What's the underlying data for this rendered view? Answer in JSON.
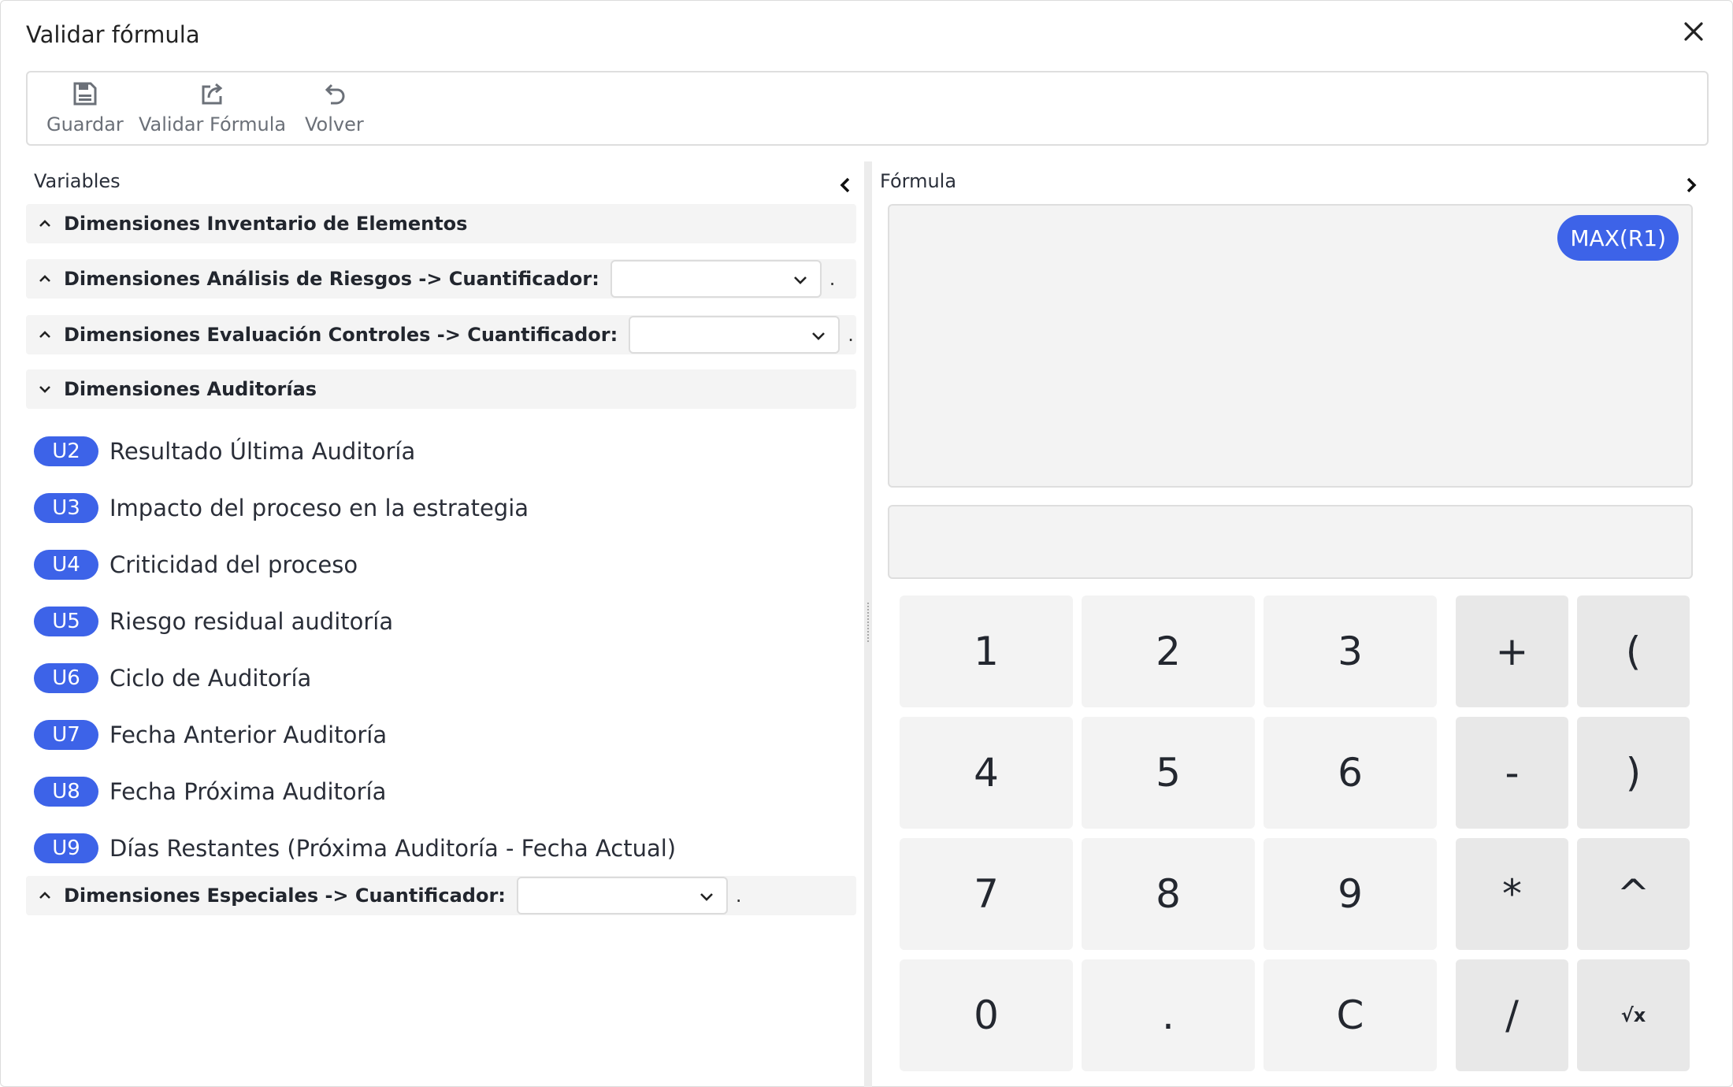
{
  "dialog": {
    "title": "Validar fórmula"
  },
  "toolbar": {
    "save_label": "Guardar",
    "validate_label": "Validar Fórmula",
    "back_label": "Volver"
  },
  "variables_panel": {
    "title": "Variables",
    "sections": [
      {
        "label": "Dimensiones Inventario de Elementos"
      },
      {
        "label": "Dimensiones Análisis de Riesgos -> Cuantificador:",
        "select_value": "",
        "suffix": "."
      },
      {
        "label": "Dimensiones Evaluación Controles -> Cuantificador:",
        "select_value": "",
        "suffix": "."
      },
      {
        "label": "Dimensiones Auditorías"
      },
      {
        "label": "Dimensiones Especiales -> Cuantificador:",
        "select_value": "",
        "suffix": "."
      }
    ],
    "audit_items": [
      {
        "code": "U2",
        "label": "Resultado Última Auditoría"
      },
      {
        "code": "U3",
        "label": "Impacto del proceso en la estrategia"
      },
      {
        "code": "U4",
        "label": "Criticidad del proceso"
      },
      {
        "code": "U5",
        "label": "Riesgo residual auditoría"
      },
      {
        "code": "U6",
        "label": "Ciclo de Auditoría"
      },
      {
        "code": "U7",
        "label": "Fecha Anterior Auditoría"
      },
      {
        "code": "U8",
        "label": "Fecha Próxima Auditoría"
      },
      {
        "code": "U9",
        "label": "Días Restantes (Próxima Auditoría - Fecha Actual)"
      }
    ]
  },
  "formula_panel": {
    "title": "Fórmula",
    "token": "MAX(R1)",
    "input_value": ""
  },
  "keypad": {
    "k1": "1",
    "k2": "2",
    "k3": "3",
    "plus": "+",
    "lparen": "(",
    "k4": "4",
    "k5": "5",
    "k6": "6",
    "minus": "-",
    "rparen": ")",
    "k7": "7",
    "k8": "8",
    "k9": "9",
    "mult": "*",
    "pow": "^",
    "k0": "0",
    "dot": ".",
    "clear": "C",
    "div": "/",
    "sqrt": "√x"
  },
  "colors": {
    "accent": "#3d63e8",
    "panel_bg": "#f4f4f4"
  },
  "icons": [
    "close-icon",
    "save-icon",
    "share-icon",
    "undo-icon",
    "chevron-left-icon",
    "chevron-right-icon",
    "chevron-up-icon",
    "chevron-down-icon"
  ]
}
